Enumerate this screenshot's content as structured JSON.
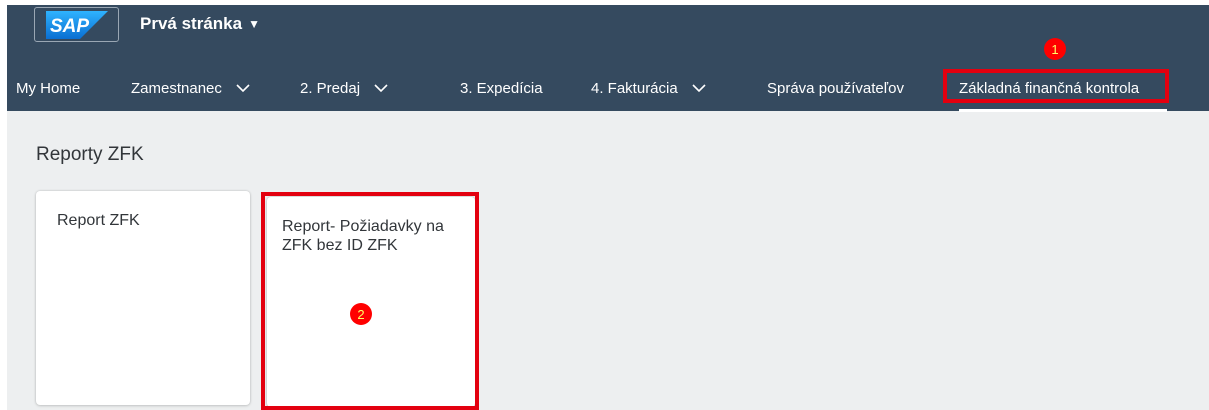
{
  "header": {
    "logo_text": "SAP",
    "app_title": "Prvá stránka",
    "app_title_caret": "▼"
  },
  "nav": {
    "items": [
      {
        "label": "My Home",
        "has_dropdown": false
      },
      {
        "label": "Zamestnanec",
        "has_dropdown": true
      },
      {
        "label": "2. Predaj",
        "has_dropdown": true
      },
      {
        "label": "3. Expedícia",
        "has_dropdown": false
      },
      {
        "label": "4. Fakturácia",
        "has_dropdown": true
      },
      {
        "label": "Správa používateľov",
        "has_dropdown": false
      },
      {
        "label": "Základná finančná kontrola",
        "has_dropdown": false,
        "active": true
      }
    ]
  },
  "main": {
    "group_title": "Reporty ZFK",
    "tiles": [
      {
        "title": "Report ZFK"
      },
      {
        "title": "Report- Požiadavky na ZFK bez ID ZFK"
      }
    ]
  },
  "annotations": {
    "markers": [
      "1",
      "2"
    ],
    "highlight_color": "#e3000f",
    "marker_color": "#ff0000"
  },
  "colors": {
    "shell": "#354a5f",
    "page_bg": "#edeff0",
    "text": "#32363a"
  }
}
